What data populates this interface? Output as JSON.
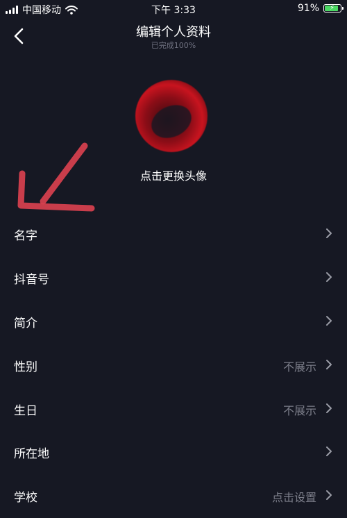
{
  "status_bar": {
    "carrier": "中国移动",
    "time": "下午 3:33",
    "battery": "91%",
    "battery_level": 0.91
  },
  "nav": {
    "title": "编辑个人资料",
    "subtitle": "已完成100%"
  },
  "avatar": {
    "change_label": "点击更换头像"
  },
  "rows": [
    {
      "label": "名字",
      "value": ""
    },
    {
      "label": "抖音号",
      "value": ""
    },
    {
      "label": "简介",
      "value": ""
    },
    {
      "label": "性别",
      "value": "不展示"
    },
    {
      "label": "生日",
      "value": "不展示"
    },
    {
      "label": "所在地",
      "value": ""
    },
    {
      "label": "学校",
      "value": "点击设置"
    }
  ],
  "colors": {
    "background": "#161823",
    "secondary_text": "#7d7f8b",
    "annotation_arrow": "#d9414f"
  }
}
